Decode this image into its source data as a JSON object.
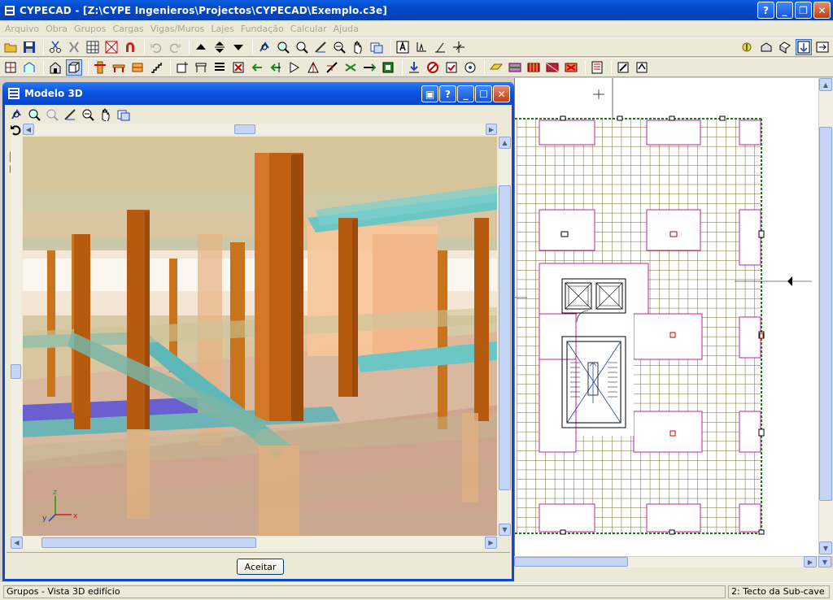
{
  "window": {
    "title": "CYPECAD - [Z:\\CYPE Ingenieros\\Projectos\\CYPECAD\\Exemplo.c3e]"
  },
  "menu": [
    "Arquivo",
    "Obra",
    "Grupos",
    "Cargas",
    "Vigas/Muros",
    "Lajes",
    "Fundação",
    "Calcular",
    "Ajuda"
  ],
  "dialog": {
    "title": "Modelo 3D",
    "accept_label": "Aceitar"
  },
  "axis": {
    "x": "x",
    "y": "y",
    "z": "z"
  },
  "status": {
    "left": "Grupos - Vista 3D edifício",
    "right": "2: Tecto da Sub-cave"
  },
  "colors": {
    "titlebar": "#0548c8",
    "plan_grid": "#6b6b20",
    "plan_border": "#c020a0",
    "column": "#b65a10",
    "beam": "#5fb8b8"
  }
}
